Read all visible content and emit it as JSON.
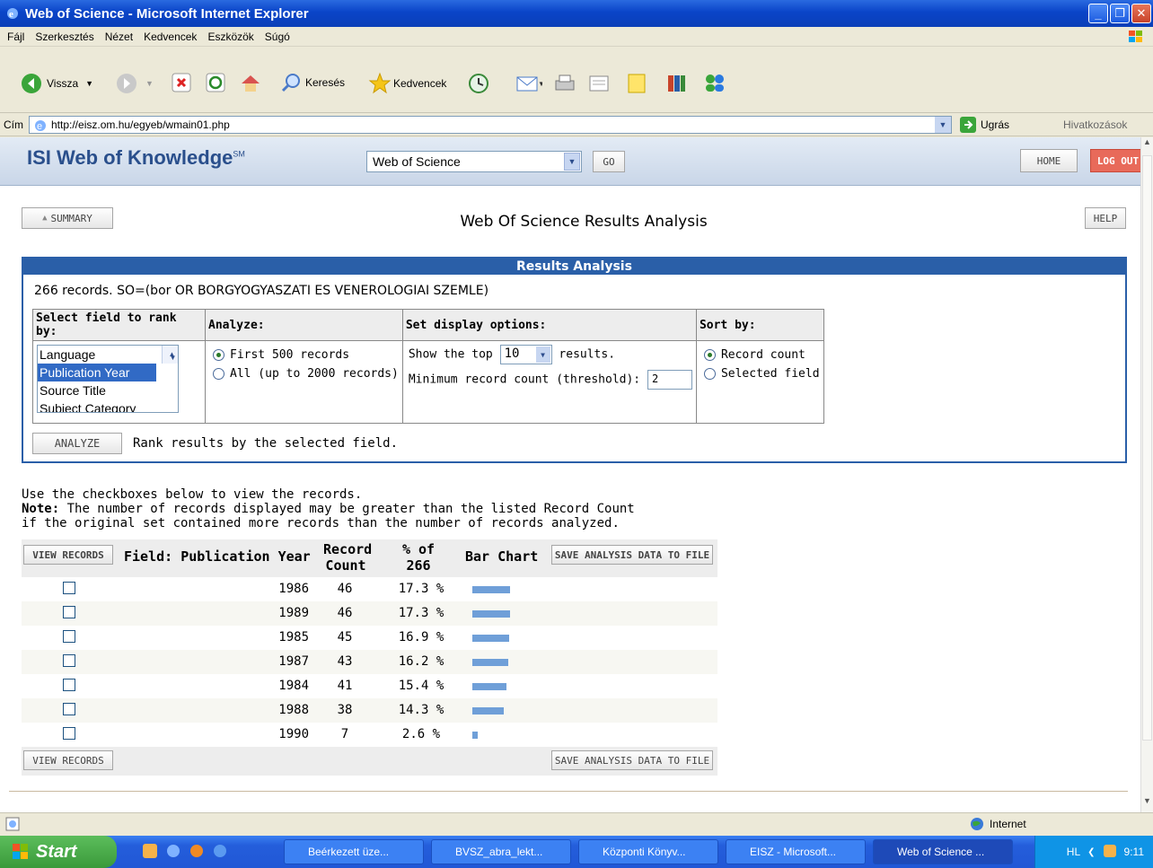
{
  "window": {
    "title": "Web of Science - Microsoft Internet Explorer"
  },
  "menu": [
    "Fájl",
    "Szerkesztés",
    "Nézet",
    "Kedvencek",
    "Eszközök",
    "Súgó"
  ],
  "toolbar": {
    "back": "Vissza",
    "search": "Keresés",
    "favorites": "Kedvencek"
  },
  "address": {
    "label": "Cím",
    "url": "http://eisz.om.hu/egyeb/wmain01.php",
    "go": "Ugrás",
    "links": "Hivatkozások"
  },
  "wok": {
    "logo": "ISI Web of Knowledge",
    "logo_sup": "SM",
    "database": "Web of Science",
    "go": "GO",
    "home": "HOME",
    "logout": "LOG OUT"
  },
  "page": {
    "summary": "SUMMARY",
    "title": "Web Of Science Results Analysis",
    "help": "HELP"
  },
  "analysis": {
    "header": "Results Analysis",
    "query": "266 records. SO=(bor OR BORGYOGYASZATI ES VENEROLOGIAI SZEMLE)",
    "col_field": "Select field to rank by:",
    "col_analyze": "Analyze:",
    "col_display": "Set display options:",
    "col_sort": "Sort by:",
    "fields": [
      "Language",
      "Publication Year",
      "Source Title",
      "Subject Category"
    ],
    "analyze_opt1": "First 500 records",
    "analyze_opt2": "All (up to 2000 records)",
    "show_top_pre": "Show the top",
    "show_top_val": "10",
    "show_top_post": "results.",
    "threshold_label": "Minimum record count (threshold):",
    "threshold_val": "2",
    "sort_opt1": "Record count",
    "sort_opt2": "Selected field",
    "analyze_btn": "ANALYZE",
    "analyze_hint": "Rank results by the selected field."
  },
  "instructions": {
    "line1": "Use the checkboxes below to view the records.",
    "note_label": "Note:",
    "note_text": " The number of records displayed may be greater than the listed Record Count",
    "line3": "if the original set contained more records than the number of records analyzed."
  },
  "results": {
    "view_records": "VIEW RECORDS",
    "col_field": "Field: Publication Year",
    "col_count_1": "Record",
    "col_count_2": "Count",
    "col_pct_1": "% of",
    "col_pct_2": "266",
    "col_bar": "Bar Chart",
    "save": "SAVE ANALYSIS DATA TO FILE",
    "rows": [
      {
        "year": "1986",
        "count": "46",
        "pct": "17.3 %",
        "share": 17.3
      },
      {
        "year": "1989",
        "count": "46",
        "pct": "17.3 %",
        "share": 17.3
      },
      {
        "year": "1985",
        "count": "45",
        "pct": "16.9 %",
        "share": 16.9
      },
      {
        "year": "1987",
        "count": "43",
        "pct": "16.2 %",
        "share": 16.2
      },
      {
        "year": "1984",
        "count": "41",
        "pct": "15.4 %",
        "share": 15.4
      },
      {
        "year": "1988",
        "count": "38",
        "pct": "14.3 %",
        "share": 14.3
      },
      {
        "year": "1990",
        "count": "7",
        "pct": "2.6 %",
        "share": 2.6
      }
    ]
  },
  "status": {
    "zone": "Internet"
  },
  "taskbar": {
    "start": "Start",
    "tasks": [
      "Beérkezett üze...",
      "BVSZ_abra_lekt...",
      "Központi Könyv...",
      "EISZ - Microsoft...",
      "Web of Science ..."
    ],
    "lang": "HL",
    "clock": "9:11"
  }
}
